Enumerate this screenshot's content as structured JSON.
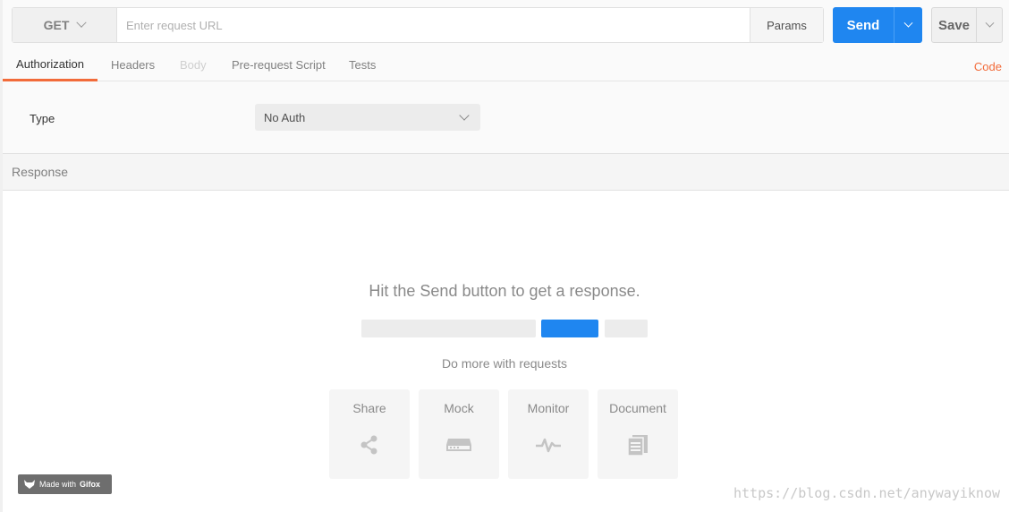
{
  "request": {
    "method": "GET",
    "url_placeholder": "Enter request URL",
    "params_label": "Params",
    "send_label": "Send",
    "save_label": "Save"
  },
  "tabs": [
    {
      "label": "Authorization",
      "state": "active"
    },
    {
      "label": "Headers",
      "state": "normal"
    },
    {
      "label": "Body",
      "state": "disabled"
    },
    {
      "label": "Pre-request Script",
      "state": "normal"
    },
    {
      "label": "Tests",
      "state": "normal"
    }
  ],
  "code_link": "Code",
  "auth": {
    "type_label": "Type",
    "type_value": "No Auth"
  },
  "response": {
    "header": "Response",
    "hint": "Hit the Send button to get a response.",
    "do_more": "Do more with requests",
    "cards": [
      {
        "label": "Share",
        "icon": "share-icon"
      },
      {
        "label": "Mock",
        "icon": "mock-server-icon"
      },
      {
        "label": "Monitor",
        "icon": "monitor-pulse-icon"
      },
      {
        "label": "Document",
        "icon": "document-icon"
      }
    ]
  },
  "gifox_badge": {
    "prefix": "Made with",
    "brand": "Gifox"
  },
  "watermark": "https://blog.csdn.net/anywayiknow",
  "colors": {
    "accent": "#1f86f0",
    "tab_active": "#f26b3a"
  }
}
